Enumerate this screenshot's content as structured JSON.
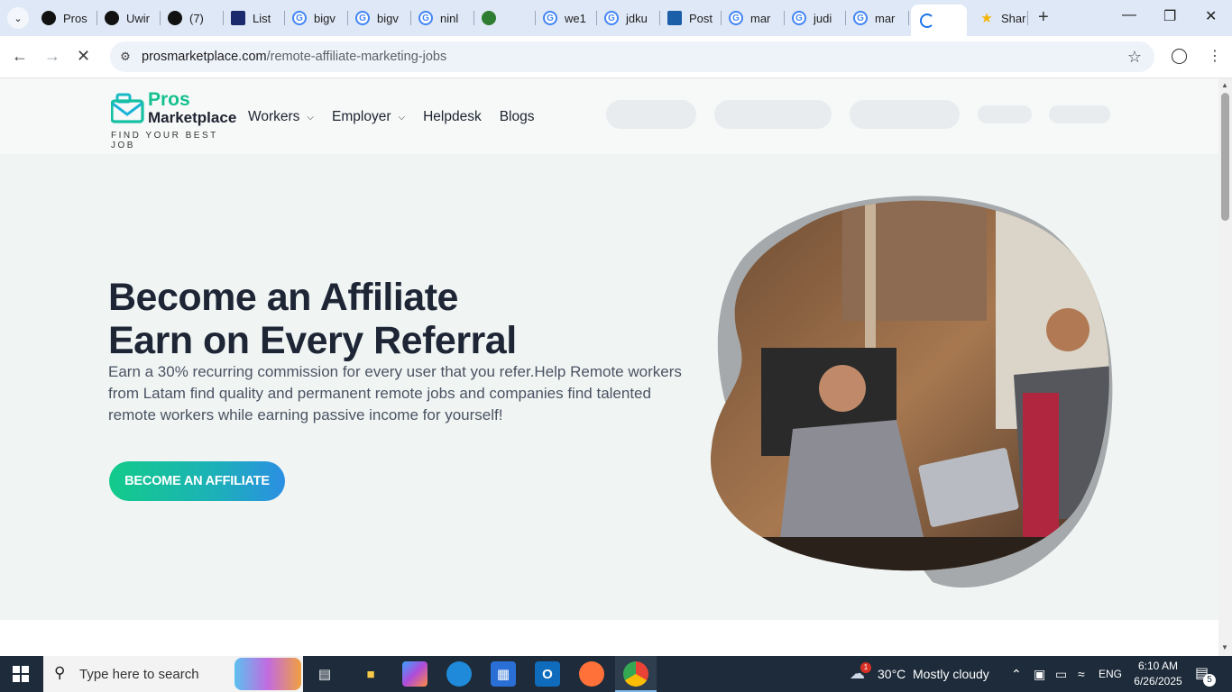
{
  "browser": {
    "tabs": [
      {
        "title": "Pros",
        "favicon": "threads-icon",
        "color": "#111111"
      },
      {
        "title": "Uwir",
        "favicon": "threads-icon",
        "color": "#111111"
      },
      {
        "title": "(7)",
        "favicon": "b-icon",
        "color": "#111111"
      },
      {
        "title": "List",
        "favicon": "ttp-icon",
        "color": "#1a2a6c"
      },
      {
        "title": "bigv",
        "favicon": "google-icon",
        "color": "#4285f4"
      },
      {
        "title": "bigv",
        "favicon": "google-icon",
        "color": "#4285f4"
      },
      {
        "title": "ninl",
        "favicon": "google-icon",
        "color": "#4285f4"
      },
      {
        "title": "",
        "favicon": "extension-icon",
        "color": "#2e7d32"
      },
      {
        "title": "we1",
        "favicon": "google-icon",
        "color": "#4285f4"
      },
      {
        "title": "jdku",
        "favicon": "google-icon",
        "color": "#4285f4"
      },
      {
        "title": "Post",
        "favicon": "xf-icon",
        "color": "#1b5fa8"
      },
      {
        "title": "mar",
        "favicon": "google-icon",
        "color": "#4285f4"
      },
      {
        "title": "judi",
        "favicon": "google-icon",
        "color": "#4285f4"
      },
      {
        "title": "mar",
        "favicon": "google-icon",
        "color": "#4285f4"
      },
      {
        "title": "",
        "favicon": "loading-icon",
        "color": "#1a73e8"
      },
      {
        "title": "Shar",
        "favicon": "star-icon",
        "color": "#f5b400"
      }
    ],
    "url_domain": "prosmarketplace.com",
    "url_path": "/remote-affiliate-marketing-jobs"
  },
  "site": {
    "logo_pros": "Pros",
    "logo_marketplace": "Marketplace",
    "logo_tagline": "FIND YOUR BEST JOB",
    "nav": {
      "workers": "Workers",
      "employer": "Employer",
      "helpdesk": "Helpdesk",
      "blogs": "Blogs"
    },
    "accent": "#13c18f"
  },
  "hero": {
    "title_line1": "Become an Affiliate",
    "title_line2": "Earn on Every Referral",
    "lead": "Earn a 30% recurring commission for every user that you refer.Help Remote workers from Latam find quality and permanent remote jobs and companies find talented remote workers while earning passive income for yourself!",
    "cta": "BECOME AN AFFILIATE"
  },
  "taskbar": {
    "search_placeholder": "Type here to search",
    "weather_temp": "30°C",
    "weather_desc": "Mostly cloudy",
    "weather_badge": "1",
    "language": "ENG",
    "time": "6:10 AM",
    "date": "6/26/2025",
    "notifications": "5"
  }
}
